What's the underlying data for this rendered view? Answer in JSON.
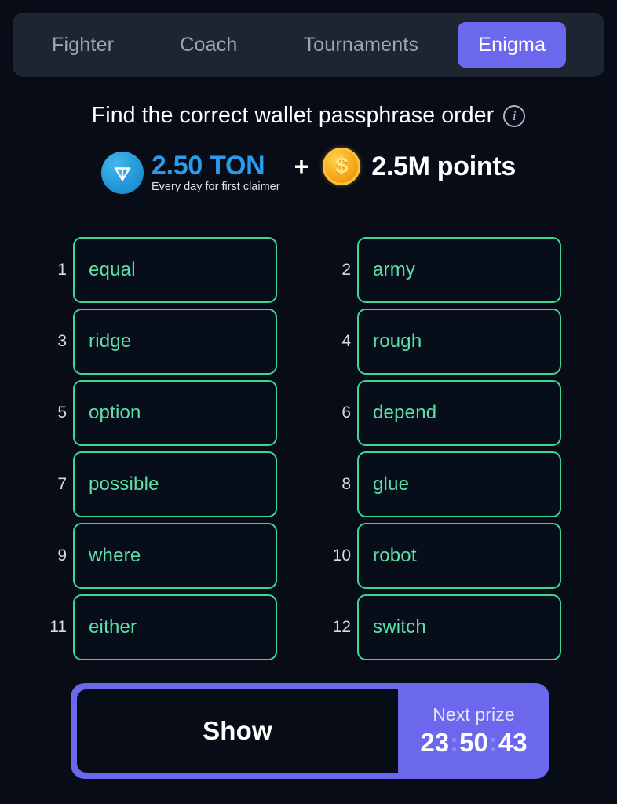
{
  "tabs": [
    {
      "label": "Fighter",
      "active": false
    },
    {
      "label": "Coach",
      "active": false
    },
    {
      "label": "Tournaments",
      "active": false
    },
    {
      "label": "Enigma",
      "active": true
    }
  ],
  "header": {
    "title": "Find the correct wallet passphrase order",
    "info_icon": "info-circle-icon"
  },
  "reward": {
    "ton_icon": "ton-logo-icon",
    "ton_amount": "2.50 TON",
    "ton_note": "Every day for first claimer",
    "separator": "+",
    "coin_icon": "dollar-coin-icon",
    "coin_symbol": "$",
    "points": "2.5M points"
  },
  "passphrase": {
    "words": [
      {
        "index": "1",
        "word": "equal"
      },
      {
        "index": "2",
        "word": "army"
      },
      {
        "index": "3",
        "word": "ridge"
      },
      {
        "index": "4",
        "word": "rough"
      },
      {
        "index": "5",
        "word": "option"
      },
      {
        "index": "6",
        "word": "depend"
      },
      {
        "index": "7",
        "word": "possible"
      },
      {
        "index": "8",
        "word": "glue"
      },
      {
        "index": "9",
        "word": "where"
      },
      {
        "index": "10",
        "word": "robot"
      },
      {
        "index": "11",
        "word": "either"
      },
      {
        "index": "12",
        "word": "switch"
      }
    ]
  },
  "footer": {
    "show_label": "Show",
    "prize_label": "Next prize",
    "timer": "23:50:43",
    "timer_hours": "23",
    "timer_minutes": "50",
    "timer_seconds": "43",
    "timer_separator": ":"
  },
  "colors": {
    "page_background": "#080c17",
    "tabbar_background": "#1d2532",
    "accent_purple": "#6b68ee",
    "tab_inactive_text": "#9aa6b6",
    "word_border_green": "#3fd694",
    "word_text_green": "#5ce0a8",
    "ton_blue": "#2b9bea",
    "coin_gold": "#f7a81b"
  }
}
